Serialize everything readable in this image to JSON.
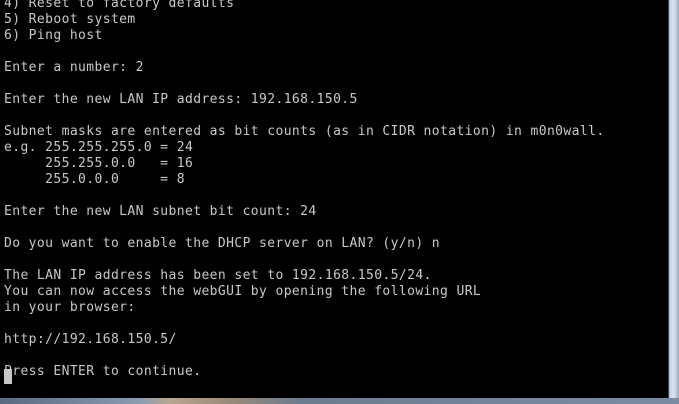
{
  "terminal": {
    "lines": [
      "4) Reset to factory defaults",
      "5) Reboot system",
      "6) Ping host",
      "",
      "Enter a number: 2",
      "",
      "Enter the new LAN IP address: 192.168.150.5",
      "",
      "Subnet masks are entered as bit counts (as in CIDR notation) in m0n0wall.",
      "e.g. 255.255.255.0 = 24",
      "     255.255.0.0   = 16",
      "     255.0.0.0     = 8",
      "",
      "Enter the new LAN subnet bit count: 24",
      "",
      "Do you want to enable the DHCP server on LAN? (y/n) n",
      "",
      "The LAN IP address has been set to 192.168.150.5/24.",
      "You can now access the webGUI by opening the following URL",
      "in your browser:",
      "",
      "http://192.168.150.5/",
      "",
      "Press ENTER to continue."
    ]
  }
}
